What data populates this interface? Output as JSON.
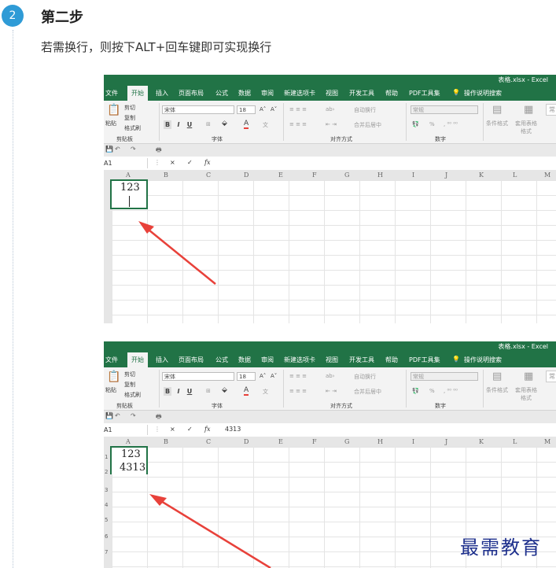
{
  "step": {
    "number": "2",
    "title": "第二步",
    "text": "若需换行，则按下ALT+回车键即可实现换行"
  },
  "excel": {
    "window_title": "表格.xlsx - Excel",
    "tabs": [
      "文件",
      "开始",
      "插入",
      "页面布局",
      "公式",
      "数据",
      "审阅",
      "新建选项卡",
      "视图",
      "开发工具",
      "帮助",
      "PDF工具集",
      "操作说明搜索"
    ],
    "active_tab": "开始",
    "clipboard": {
      "paste": "粘贴",
      "cut": "剪切",
      "copy": "复制",
      "format_painter": "格式刷",
      "label": "剪贴板"
    },
    "font": {
      "name": "宋体",
      "size": "18",
      "label": "字体",
      "bold": "B",
      "italic": "I",
      "underline": "U"
    },
    "alignment": {
      "wrap": "自动换行",
      "merge": "合并后居中",
      "label": "对齐方式"
    },
    "number": {
      "format": "常规",
      "label": "数字",
      "percent": "%"
    },
    "styles": {
      "conditional": "条件格式",
      "table": "套用表格格式",
      "cell": "常"
    },
    "formula_bar": {
      "cancel": "×",
      "enter": "✓",
      "fx": "fx"
    },
    "columns": [
      "A",
      "B",
      "C",
      "D",
      "E",
      "F",
      "G",
      "H",
      "I",
      "J",
      "K",
      "L",
      "M"
    ],
    "rows": [
      "1",
      "2",
      "3",
      "4",
      "5",
      "6",
      "7"
    ]
  },
  "shot1": {
    "name_box": "A1",
    "formula": "",
    "cell_a1": "123"
  },
  "shot2": {
    "name_box": "A1",
    "formula": "4313",
    "cell_a1_line1": "123",
    "cell_a1_line2": "4313"
  },
  "watermark": "最需教育",
  "colors": {
    "excel_green": "#217346",
    "arrow_red": "#e8413a",
    "badge_blue": "#2f9bd6",
    "watermark_blue": "#1d2f8c"
  }
}
